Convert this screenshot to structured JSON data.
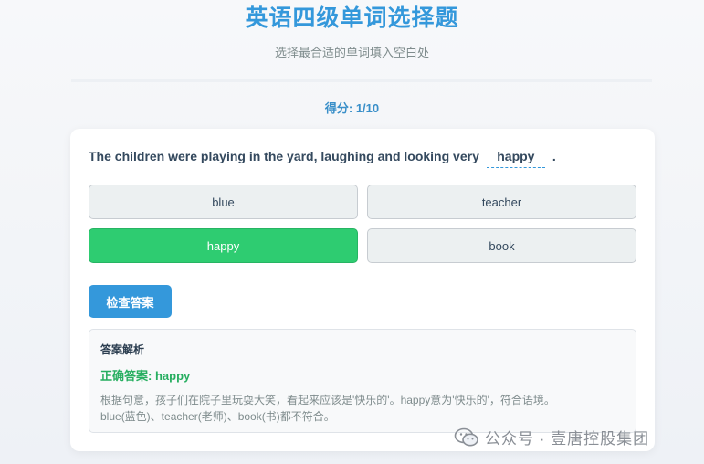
{
  "header": {
    "title": "英语四级单词选择题",
    "subtitle": "选择最合适的单词填入空白处"
  },
  "score": {
    "label": "得分:",
    "value": "1/10"
  },
  "question": {
    "before": "The children were playing in the yard, laughing and looking very",
    "blank": "happy",
    "after": "."
  },
  "options": [
    {
      "label": "blue",
      "selected": false
    },
    {
      "label": "teacher",
      "selected": false
    },
    {
      "label": "happy",
      "selected": true
    },
    {
      "label": "book",
      "selected": false
    }
  ],
  "check_button": "检查答案",
  "explanation": {
    "title": "答案解析",
    "answer_label": "正确答案:",
    "answer_value": "happy",
    "text_line1": "根据句意，孩子们在院子里玩耍大笑，看起来应该是'快乐的'。happy意为'快乐的'，符合语境。",
    "text_line2": "blue(蓝色)、teacher(老师)、book(书)都不符合。"
  },
  "watermark": {
    "text": "公众号 · 壹唐控股集团",
    "icon": "wechat-icon"
  },
  "colors": {
    "accent": "#3498db",
    "selected": "#2ecc71",
    "correct": "#27ae60"
  }
}
